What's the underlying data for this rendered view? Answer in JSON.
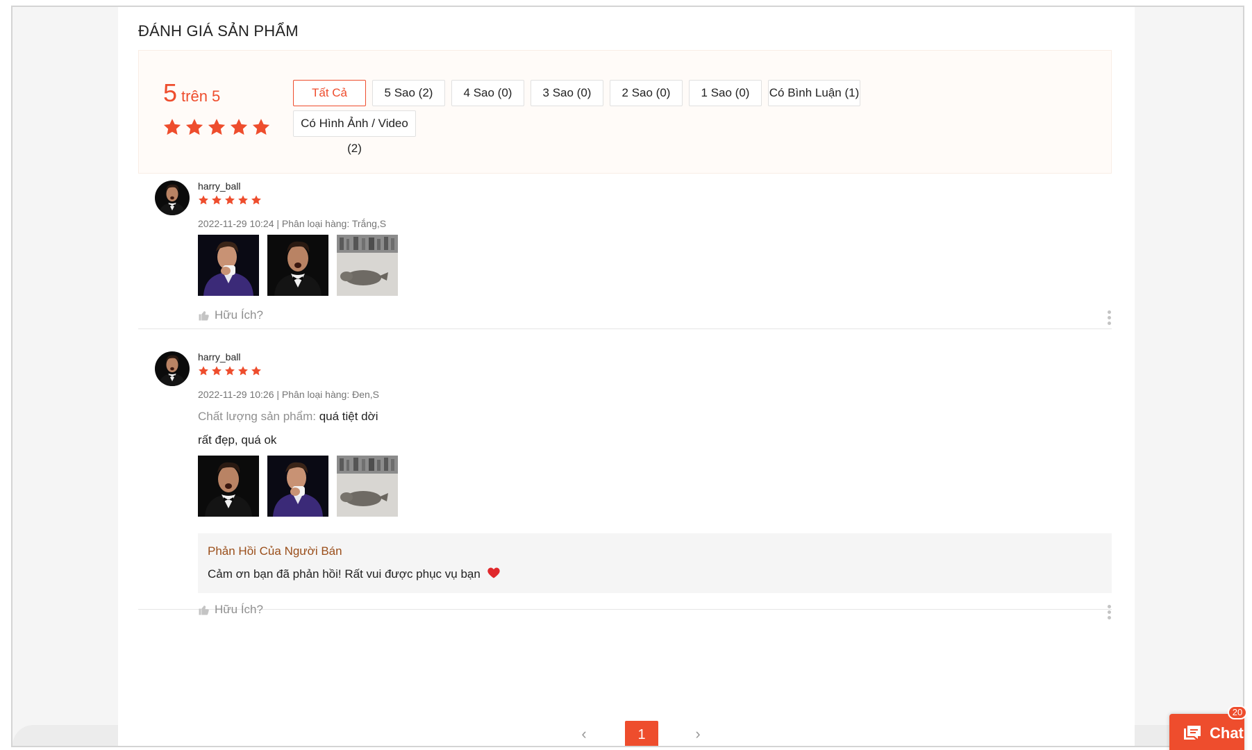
{
  "section": {
    "title": "ĐÁNH GIÁ SẢN PHẨM"
  },
  "overview": {
    "score": "5",
    "score_suffix": "trên 5",
    "rating": 5,
    "filters": [
      {
        "label": "Tất Cả",
        "active": true
      },
      {
        "label": "5 Sao (2)",
        "active": false
      },
      {
        "label": "4 Sao (0)",
        "active": false
      },
      {
        "label": "3 Sao (0)",
        "active": false
      },
      {
        "label": "2 Sao (0)",
        "active": false
      },
      {
        "label": "1 Sao (0)",
        "active": false
      },
      {
        "label": "Có Bình Luận (1)",
        "active": false
      },
      {
        "label": "Có Hình Ảnh / Video (2)",
        "active": false
      }
    ]
  },
  "reviews": [
    {
      "username": "harry_ball",
      "rating": 5,
      "meta": "2022-11-29 10:24 | Phân loại hàng: Trắng,S",
      "media": [
        "photo-man-purple-suit",
        "photo-man-tuxedo",
        "photo-seal-on-floor"
      ],
      "helpful_label": "Hữu Ích?"
    },
    {
      "username": "harry_ball",
      "rating": 5,
      "meta": "2022-11-29 10:26 | Phân loại hàng: Đen,S",
      "attr_key": "Chất lượng sản phẩm:",
      "attr_value": "quá tiệt dời",
      "comment": "rất đẹp, quá ok",
      "media": [
        "photo-man-tuxedo",
        "photo-man-purple-suit",
        "photo-seal-on-floor"
      ],
      "reply_title": "Phản Hồi Của Người Bán",
      "reply_body": "Cảm ơn bạn đã phản hồi! Rất vui được phục vụ bạn",
      "helpful_label": "Hữu Ích?"
    }
  ],
  "pagination": {
    "prev": "‹",
    "current": "1",
    "next": "›"
  },
  "chat": {
    "label": "Chat",
    "badge": "20"
  },
  "colors": {
    "accent": "#ee4d2d",
    "reply_title": "#9a4e1a"
  }
}
